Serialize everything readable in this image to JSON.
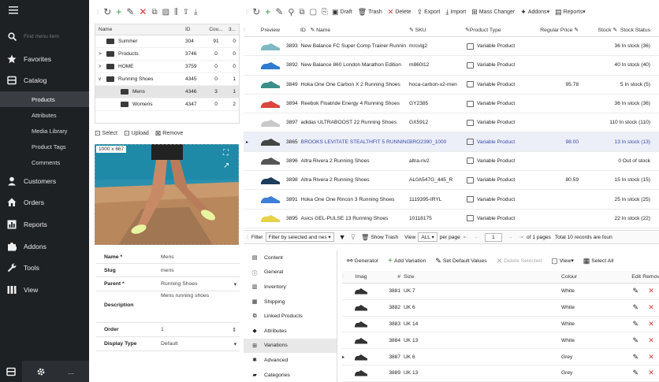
{
  "sidebar": {
    "search_placeholder": "Find menu item",
    "favorites": "Favorites",
    "catalog": "Catalog",
    "catalog_items": [
      "Products",
      "Attributes",
      "Media Library",
      "Product Tags",
      "Comments"
    ],
    "customers": "Customers",
    "orders": "Orders",
    "reports": "Reports",
    "addons": "Addons",
    "tools": "Tools",
    "view": "View",
    "footer_more": "..."
  },
  "toolbar_right": {
    "draft": "Draft",
    "trash": "Trash",
    "delete": "Delete",
    "export": "Export",
    "import": "Import",
    "mass_changer": "Mass Changer",
    "addons": "Addons",
    "reports": "Reports"
  },
  "tree": {
    "headers": [
      "Name",
      "ID",
      "Cou...",
      "3...",
      "L"
    ],
    "rows": [
      {
        "name": "Summer",
        "id": "304",
        "count": "91",
        "l": "0",
        "expand": ""
      },
      {
        "name": "Products",
        "id": "3746",
        "count": "0",
        "l": "0",
        "expand": ">"
      },
      {
        "name": "HOME",
        "id": "3759",
        "count": "0",
        "l": "0",
        "expand": ">"
      },
      {
        "name": "Running Shoes",
        "id": "4345",
        "count": "0",
        "l": "1",
        "expand": "v"
      },
      {
        "name": "Mens",
        "id": "4346",
        "count": "3",
        "l": "1",
        "expand": ""
      },
      {
        "name": "Womens",
        "id": "4347",
        "count": "0",
        "l": "2",
        "expand": ""
      }
    ]
  },
  "selbar": {
    "select": "Select",
    "upload": "Upload",
    "remove": "Remove"
  },
  "image": {
    "dims": "1000 x 667"
  },
  "form": {
    "name_label": "Name *",
    "name_value": "Mens",
    "slug_label": "Slug",
    "slug_value": "mens",
    "parent_label": "Parent *",
    "parent_value": "Running Shoes",
    "description_label": "Description",
    "description_value": "Mens running shoes",
    "order_label": "Order",
    "order_value": "1",
    "display_label": "Display Type",
    "display_value": "Default"
  },
  "grid": {
    "headers": {
      "preview": "Preview",
      "id": "ID",
      "name": "Name",
      "sku": "SKU",
      "ptype": "Product Type",
      "price": "Regular Price",
      "stock": "Stock",
      "status": "Stock Status"
    },
    "rows": [
      {
        "id": "3893",
        "name": "New Balance FC Super Comp Trainer Runnin",
        "sku": "mrcvlg2",
        "type": "Variable Product",
        "price": "",
        "status": "36 In stock (36)",
        "color": "#7fb9c4"
      },
      {
        "id": "3892",
        "name": "New Balance 860 London Marathon Edition",
        "sku": "m860l12",
        "type": "Variable Product",
        "price": "",
        "status": "40 In stock (40)",
        "color": "#2f7bd0"
      },
      {
        "id": "3849",
        "name": "Hoka One One Carbon X 2 Running Shoes",
        "sku": "hoca-carbon-x2-men",
        "type": "Variable Product",
        "price": "95.78",
        "status": "5 In stock (5)",
        "color": "#3a8f8a"
      },
      {
        "id": "3894",
        "name": "Reebok Floatride Energy 4 Running Shoes",
        "sku": "GY2385",
        "type": "Variable Product",
        "price": "",
        "status": "36 In stock (36)",
        "color": "#d9473f"
      },
      {
        "id": "3897",
        "name": "adidas ULTRABOOST 22 Running Shoes",
        "sku": "GX5912",
        "type": "Variable Product",
        "price": "",
        "status": "110 In stock (110)",
        "color": "#c9c9c9"
      },
      {
        "id": "3865",
        "name": "BROOKS LEVITATE STEALTHFIT 5 RUNNING S",
        "sku": "BRO2390_1000",
        "type": "Variable Product",
        "price": "98.00",
        "status": "13 In stock (13)",
        "color": "#444"
      },
      {
        "id": "3896",
        "name": "Altra Rivera 2 Running Shoes",
        "sku": "altra-riv2",
        "type": "Variable Product",
        "price": "",
        "status": "0 Out of stock",
        "color": "#555"
      },
      {
        "id": "3898",
        "name": "Altra Rivera 2 Running Shoes",
        "sku": "AL0A547G_445_R",
        "type": "Variable Product",
        "price": "80.59",
        "status": "15 In stock (15)",
        "color": "#1d3c5e"
      },
      {
        "id": "3891",
        "name": "Hoka One One Rincon 3 Running Shoes",
        "sku": "1119395-IRYL",
        "type": "Variable Product",
        "price": "",
        "status": "25 In stock (25)",
        "color": "#3d7fd6"
      },
      {
        "id": "3895",
        "name": "Asics GEL-PULSE 13 Running Shoes",
        "sku": "10118175",
        "type": "Variable Product",
        "price": "",
        "status": "22 In stock (22)",
        "color": "#e7d24a"
      }
    ]
  },
  "filterbar": {
    "filter": "Filter",
    "filter_value": "Filter by selected and nes",
    "show_trash": "Show Trash",
    "view": "View",
    "view_value": "ALL",
    "per_page": "per page",
    "page": "1",
    "of_pages": "of 1 pages",
    "total": "Total 10 records are foun"
  },
  "tabs": [
    "Content",
    "General",
    "Inventory",
    "Shipping",
    "Linked Products",
    "Attributes",
    "Variations",
    "Advanced",
    "Categories"
  ],
  "vtool": {
    "generator": "Generator",
    "add": "Add Variation",
    "set_default": "Set Default Values",
    "delete_sel": "Delete Selected",
    "view": "View",
    "select_all": "Select All"
  },
  "vgrid": {
    "headers": {
      "img": "Imag",
      "num": "#",
      "size": "Size",
      "colour": "Colour",
      "edit": "Edit",
      "remove": "Remov"
    },
    "rows": [
      {
        "id": "3881",
        "size": "UK 7",
        "colour": "White"
      },
      {
        "id": "3882",
        "size": "UK 6",
        "colour": "White"
      },
      {
        "id": "3883",
        "size": "UK 14",
        "colour": "White"
      },
      {
        "id": "3884",
        "size": "UK 13",
        "colour": "White"
      },
      {
        "id": "3887",
        "size": "UK 6",
        "colour": "Grey"
      },
      {
        "id": "3889",
        "size": "UK 13",
        "colour": "Grey"
      }
    ]
  }
}
